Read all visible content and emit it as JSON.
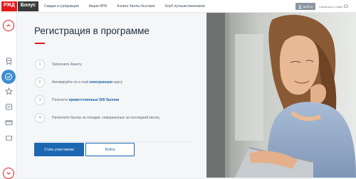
{
  "brand": {
    "part1": "РЖД",
    "part2": "Бонус"
  },
  "nav": {
    "items": [
      "Скидки и суперакции",
      "Акции ФПК",
      "Копить баллы быстрее",
      "Клуб путешественников"
    ]
  },
  "header": {
    "login_label": "ВОЙТИ",
    "contact_label": "Связаться с нами"
  },
  "page": {
    "title": "Регистрация в программе",
    "steps": [
      {
        "num": "1",
        "before": "Заполните Анкету",
        "link": "",
        "after": ""
      },
      {
        "num": "2",
        "before": "Активируйте по e-mail ",
        "link": "электронную",
        "after": " карту"
      },
      {
        "num": "3",
        "before": "Получите ",
        "link": "приветственные 500 баллов",
        "after": ""
      },
      {
        "num": "4",
        "before": "Начислите баллы за поездки, совершенные за последний месяц",
        "link": "",
        "after": ""
      }
    ],
    "primary_button": "Стать участником",
    "secondary_button": "Войти"
  },
  "colors": {
    "brand_red": "#e21a1a",
    "accent_blue": "#1c67b1",
    "sidebar_active": "#3e8ed0"
  }
}
